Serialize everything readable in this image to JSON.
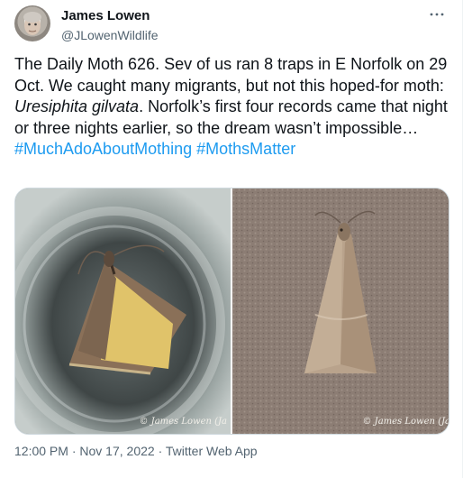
{
  "author": {
    "display_name": "James Lowen",
    "handle": "@JLowenWildlife"
  },
  "more_icon": "more-horizontal-icon",
  "tweet": {
    "text_plain": "The Daily Moth 626. Sev of us ran 8 traps in E Norfolk on 29 Oct. We caught many migrants, but not this hoped-for moth: ",
    "species": "Uresiphita gilvata",
    "text_after": ". Norfolk’s first four records came that night or three nights earlier, so the dream wasn’t impossible… ",
    "hashtag1": "#MuchAdoAboutMothing",
    "hashtag2": "#MothsMatter"
  },
  "media": {
    "left_credit": "© James Lowen (Ja",
    "right_credit": "© James Lowen (Ja"
  },
  "meta": {
    "time": "12:00 PM",
    "separator1": " · ",
    "date": "Nov 17, 2022",
    "separator2": " · ",
    "source": "Twitter Web App"
  },
  "colors": {
    "link": "#1d9bf0",
    "secondary_text": "#536471",
    "primary_text": "#0f1419"
  }
}
